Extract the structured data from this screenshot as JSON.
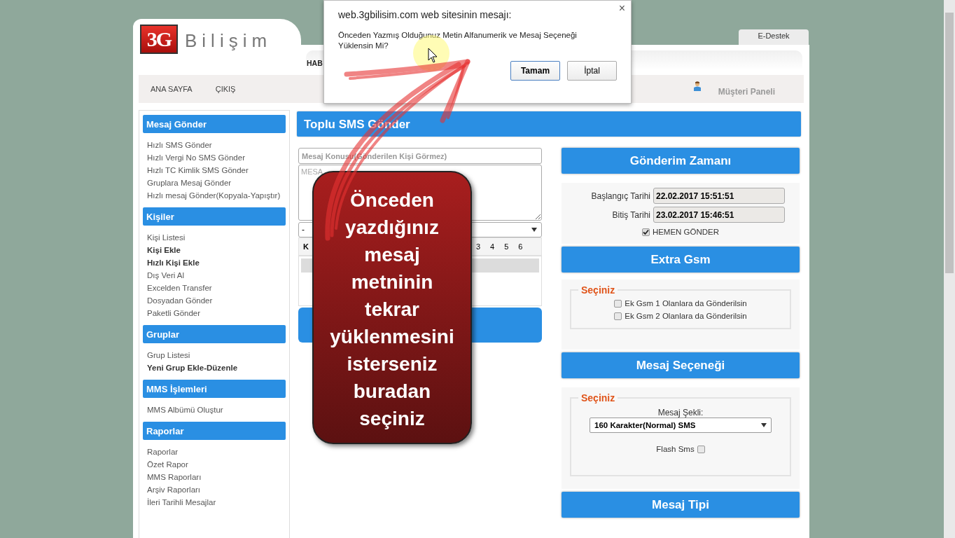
{
  "header": {
    "brand_badge": "3G",
    "brand_name": "Bilişim",
    "top_tabs": [
      {
        "label": "HAB"
      }
    ],
    "support_tab": "E-Destek"
  },
  "nav": {
    "links": [
      "ANA SAYFA",
      "ÇIKIŞ"
    ],
    "customer_panel": "Müşteri Paneli"
  },
  "sidebar": [
    {
      "title": "Mesaj Gönder",
      "items": [
        {
          "label": "Hızlı SMS Gönder",
          "bold": false
        },
        {
          "label": "Hızlı Vergi No SMS Gönder",
          "bold": false
        },
        {
          "label": "Hızlı TC Kimlik SMS Gönder",
          "bold": false
        },
        {
          "label": "Gruplara Mesaj Gönder",
          "bold": false
        },
        {
          "label": "Hızlı mesaj Gönder(Kopyala-Yapıştır)",
          "bold": false
        }
      ]
    },
    {
      "title": "Kişiler",
      "items": [
        {
          "label": "Kişi Listesi",
          "bold": false
        },
        {
          "label": "Kişi Ekle",
          "bold": true
        },
        {
          "label": "Hızlı Kişi Ekle",
          "bold": true
        },
        {
          "label": "Dış Veri Al",
          "bold": false
        },
        {
          "label": "Excelden Transfer",
          "bold": false
        },
        {
          "label": "Dosyadan Gönder",
          "bold": false
        },
        {
          "label": "Paketli Gönder",
          "bold": false
        }
      ]
    },
    {
      "title": "Gruplar",
      "items": [
        {
          "label": "Grup Listesi",
          "bold": false
        },
        {
          "label": "Yeni Grup Ekle-Düzenle",
          "bold": true
        }
      ]
    },
    {
      "title": "MMS İşlemleri",
      "items": [
        {
          "label": "MMS Albümü Oluştur",
          "bold": false
        }
      ]
    },
    {
      "title": "Raporlar",
      "items": [
        {
          "label": "Raporlar",
          "bold": false
        },
        {
          "label": "Özet Rapor",
          "bold": false
        },
        {
          "label": "MMS Raporları",
          "bold": false
        },
        {
          "label": "Arşiv Raporları",
          "bold": false
        },
        {
          "label": "İleri Tarihli Mesajlar",
          "bold": false
        }
      ]
    }
  ],
  "main": {
    "title": "Toplu SMS Gönder",
    "subject_placeholder": "Mesaj Konusu(Gönderilen Kişi Görmez)",
    "message_placeholder": "MESA",
    "select_value": "-",
    "row_labels": [
      "K",
      "3",
      "4",
      "5",
      "6"
    ]
  },
  "schedule": {
    "title": "Gönderim Zamanı",
    "start_label": "Başlangıç Tarihi",
    "start_value": "22.02.2017 15:51:51",
    "end_label": "Bitiş Tarihi",
    "end_value": "23.02.2017 15:46:51",
    "send_now": {
      "label": "HEMEN GÖNDER",
      "checked": true
    }
  },
  "extra_gsm": {
    "title": "Extra Gsm",
    "legend": "Seçiniz",
    "options": [
      {
        "label": "Ek Gsm 1 Olanlara da Gönderilsin",
        "checked": false
      },
      {
        "label": "Ek Gsm 2 Olanlara da Gönderilsin",
        "checked": false
      }
    ]
  },
  "message_option": {
    "title": "Mesaj Seçeneği",
    "legend": "Seçiniz",
    "format_label": "Mesaj Şekli:",
    "format_value": "160 Karakter(Normal) SMS",
    "flash": {
      "label": "Flash Sms",
      "checked": false
    }
  },
  "message_type": {
    "title": "Mesaj Tipi"
  },
  "dialog": {
    "title": "web.3gbilisim.com web sitesinin mesajı:",
    "message": "Önceden Yazmış Olduğunuz Metin Alfanumerik ve Mesaj Seçeneği Yüklensin Mi?",
    "close": "×",
    "buttons": [
      {
        "label": "Tamam",
        "selected": true
      },
      {
        "label": "İptal",
        "selected": false
      }
    ]
  },
  "callout": {
    "text": "Önceden yazdığınız mesaj metninin tekrar yüklenmesini isterseniz buradan seçiniz"
  }
}
